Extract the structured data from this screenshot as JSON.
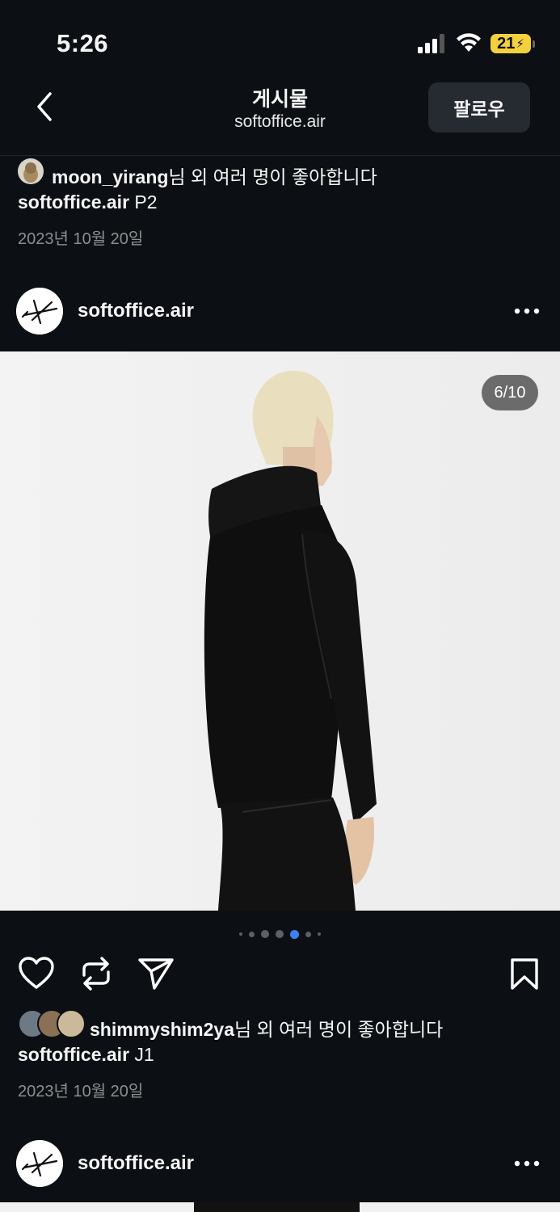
{
  "status_bar": {
    "time": "5:26",
    "battery": "21"
  },
  "header": {
    "title": "게시물",
    "subtitle": "softoffice.air",
    "follow_label": "팔로우"
  },
  "previous_post": {
    "liked_by_user": "moon_yirang",
    "liked_by_suffix": "님 외 여러 명이 좋아합니다",
    "caption_user": "softoffice.air",
    "caption_text": " P2",
    "date": "2023년 10월 20일"
  },
  "post": {
    "username": "softoffice.air",
    "counter": "6/10",
    "carousel": {
      "total_visible_dots": 7,
      "active_index": 4
    },
    "liked_by_user": "shimmyshim2ya",
    "liked_by_suffix": "님 외 여러 명이 좋아합니다",
    "caption_user": "softoffice.air",
    "caption_text": " J1",
    "date": "2023년 10월 20일"
  },
  "next_post": {
    "username": "softoffice.air"
  },
  "colors": {
    "background": "#0c1014",
    "follow_button": "#262b31",
    "active_dot": "#3b82f6",
    "battery": "#f4d03f"
  }
}
